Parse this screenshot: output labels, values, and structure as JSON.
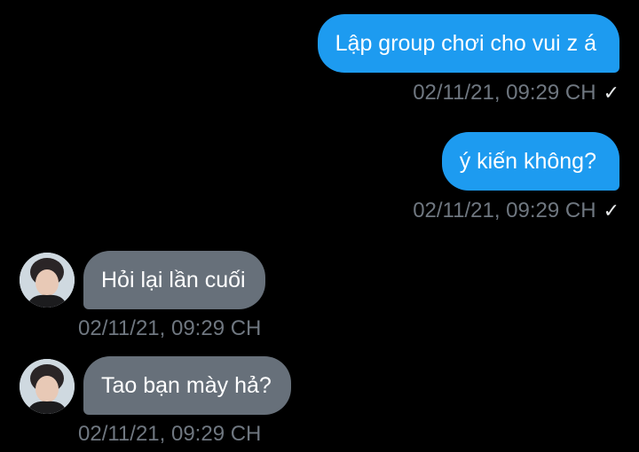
{
  "messages": [
    {
      "direction": "sent",
      "text": "Lập group chơi cho vui z á",
      "time": "02/11/21, 09:29 CH",
      "status_icon": "check-icon"
    },
    {
      "direction": "sent",
      "text": "ý kiến không?",
      "time": "02/11/21, 09:29 CH",
      "status_icon": "check-icon"
    },
    {
      "direction": "received",
      "text": "Hỏi lại lần cuối",
      "time": "02/11/21, 09:29 CH",
      "avatar": "user-avatar"
    },
    {
      "direction": "received",
      "text": "Tao bạn mày hả?",
      "time": "02/11/21, 09:29 CH",
      "avatar": "user-avatar"
    }
  ],
  "colors": {
    "background": "#000000",
    "sent_bubble": "#1d9bf0",
    "received_bubble": "#67707a",
    "timestamp": "#6f7780"
  }
}
